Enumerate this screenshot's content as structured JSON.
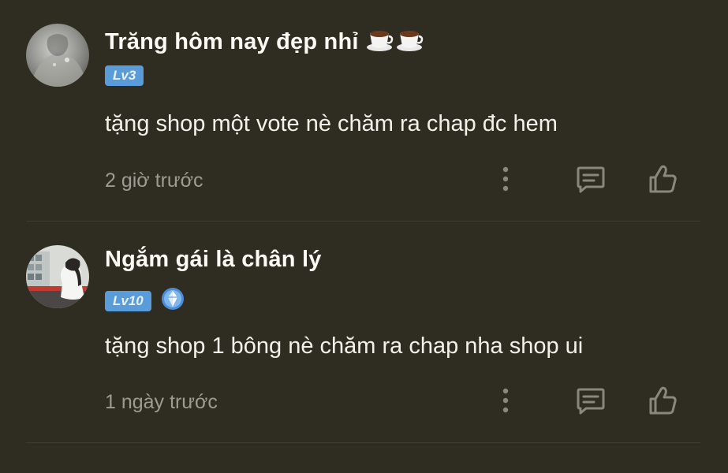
{
  "comments": [
    {
      "username": "Trăng hôm nay đẹp nhỉ",
      "username_icons": [
        "coffee-cup-emoji",
        "coffee-cup-emoji"
      ],
      "level": "Lv3",
      "content": "tặng shop một vote nè chăm ra chap đc hem",
      "time": "2 giờ trước"
    },
    {
      "username": "Ngắm gái là chân lý",
      "username_icons": [],
      "level": "Lv10",
      "rank_badge_icon": "crystal-rank-icon",
      "content": "tặng shop 1 bông nè chăm ra chap nha shop ui",
      "time": "1 ngày trước"
    }
  ],
  "colors": {
    "background": "#2f2d22",
    "level_badge": "#5a9bd9",
    "muted_text": "#9e9c92",
    "icon": "#8a887d"
  },
  "icons": {
    "more": "more-vertical-icon",
    "reply": "reply-comment-icon",
    "like": "thumbs-up-icon"
  }
}
